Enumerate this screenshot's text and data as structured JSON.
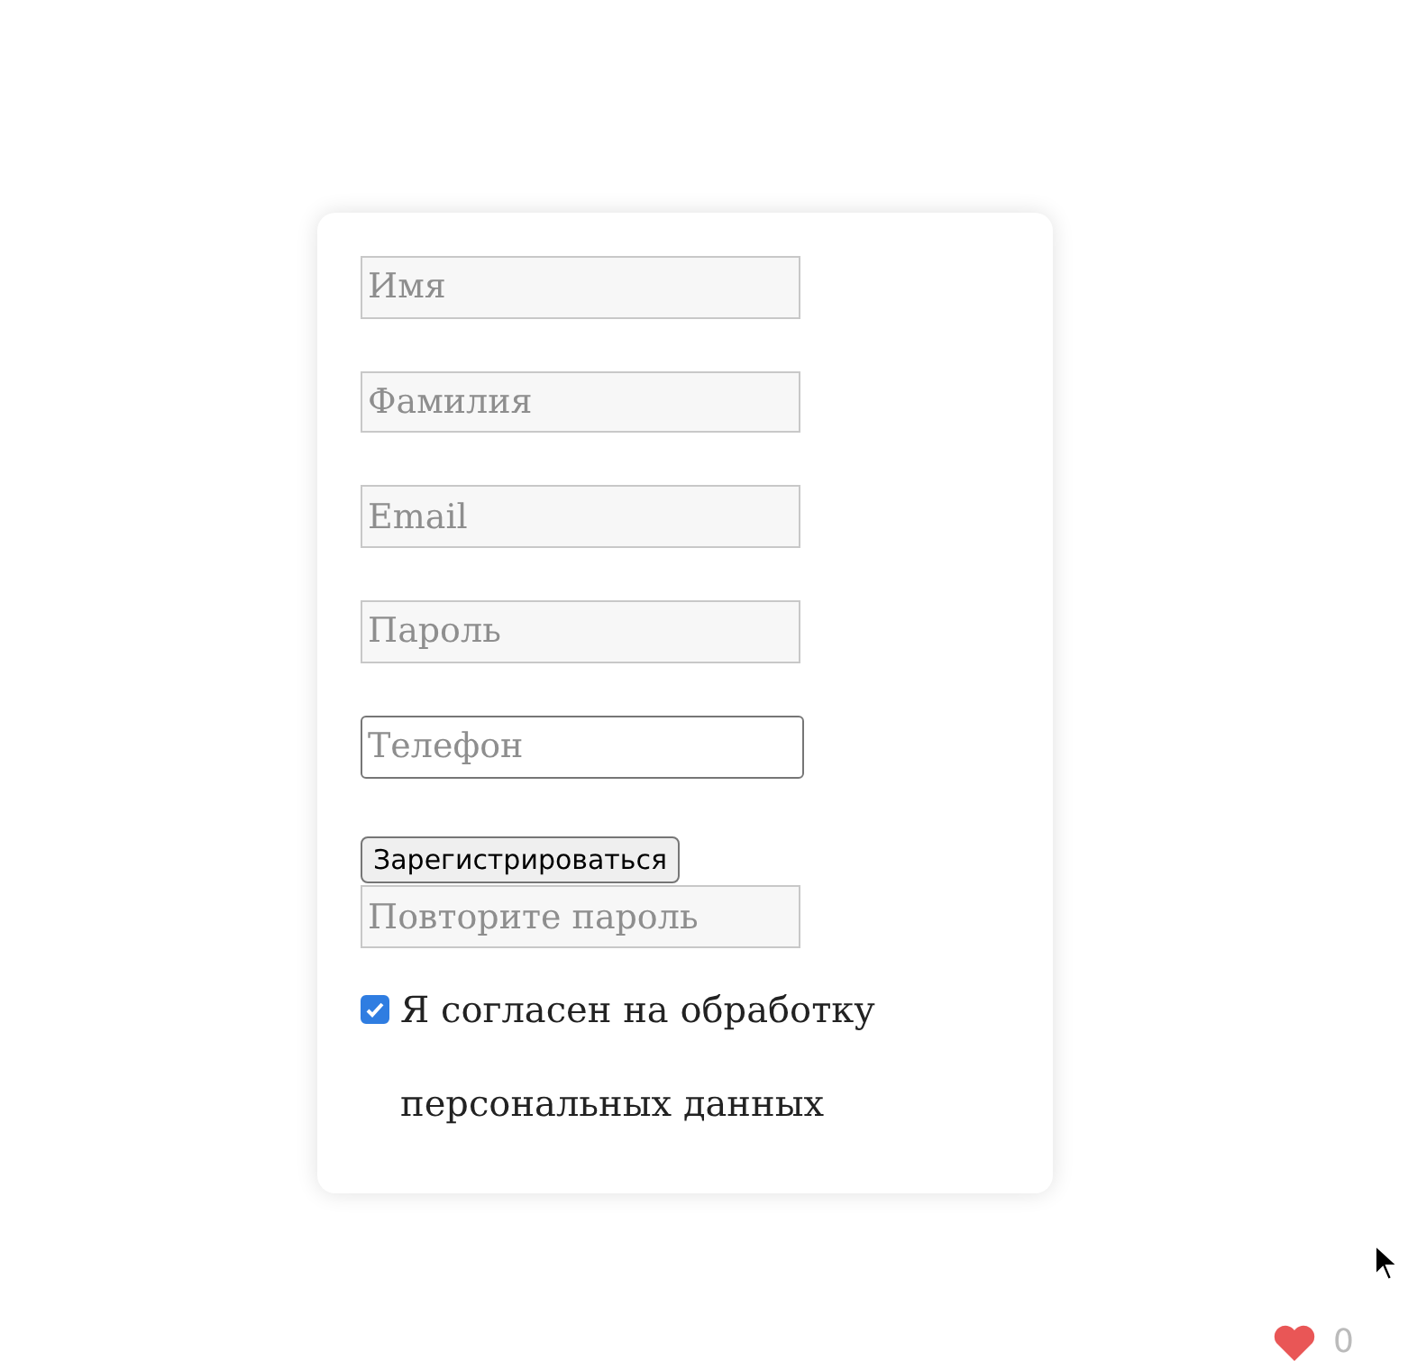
{
  "form": {
    "fields": [
      {
        "kind": "styled",
        "placeholder": "Имя"
      },
      {
        "kind": "styled",
        "placeholder": "Фамилия"
      },
      {
        "kind": "styled",
        "placeholder": "Email"
      },
      {
        "kind": "styled",
        "placeholder": "Пароль"
      },
      {
        "kind": "plain",
        "placeholder": "Телефон"
      },
      {
        "kind": "button",
        "label": "Зарегистрироваться"
      },
      {
        "kind": "styled",
        "placeholder": "Повторите пароль"
      }
    ],
    "consent": {
      "checked": true,
      "label": "Я согласен на обработку персональных данных"
    }
  },
  "likes": {
    "count": "0"
  }
}
